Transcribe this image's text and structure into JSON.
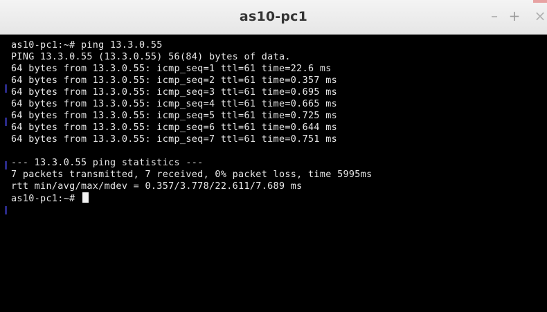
{
  "window": {
    "title": "as10-pc1",
    "buttons": {
      "minimize": "–",
      "maximize": "+",
      "close": "×"
    }
  },
  "terminal": {
    "lines": [
      "as10-pc1:~# ping 13.3.0.55",
      "PING 13.3.0.55 (13.3.0.55) 56(84) bytes of data.",
      "64 bytes from 13.3.0.55: icmp_seq=1 ttl=61 time=22.6 ms",
      "64 bytes from 13.3.0.55: icmp_seq=2 ttl=61 time=0.357 ms",
      "64 bytes from 13.3.0.55: icmp_seq=3 ttl=61 time=0.695 ms",
      "64 bytes from 13.3.0.55: icmp_seq=4 ttl=61 time=0.665 ms",
      "64 bytes from 13.3.0.55: icmp_seq=5 ttl=61 time=0.725 ms",
      "64 bytes from 13.3.0.55: icmp_seq=6 ttl=61 time=0.644 ms",
      "64 bytes from 13.3.0.55: icmp_seq=7 ttl=61 time=0.751 ms",
      "",
      "--- 13.3.0.55 ping statistics ---",
      "7 packets transmitted, 7 received, 0% packet loss, time 5995ms",
      "rtt min/avg/max/mdev = 0.357/3.778/22.611/7.689 ms"
    ],
    "prompt": "as10-pc1:~# "
  },
  "colors": {
    "terminal_background": "#000000",
    "terminal_foreground": "#e8e8e8",
    "titlebar_background": "#eeeeee",
    "title_text": "#333333"
  }
}
